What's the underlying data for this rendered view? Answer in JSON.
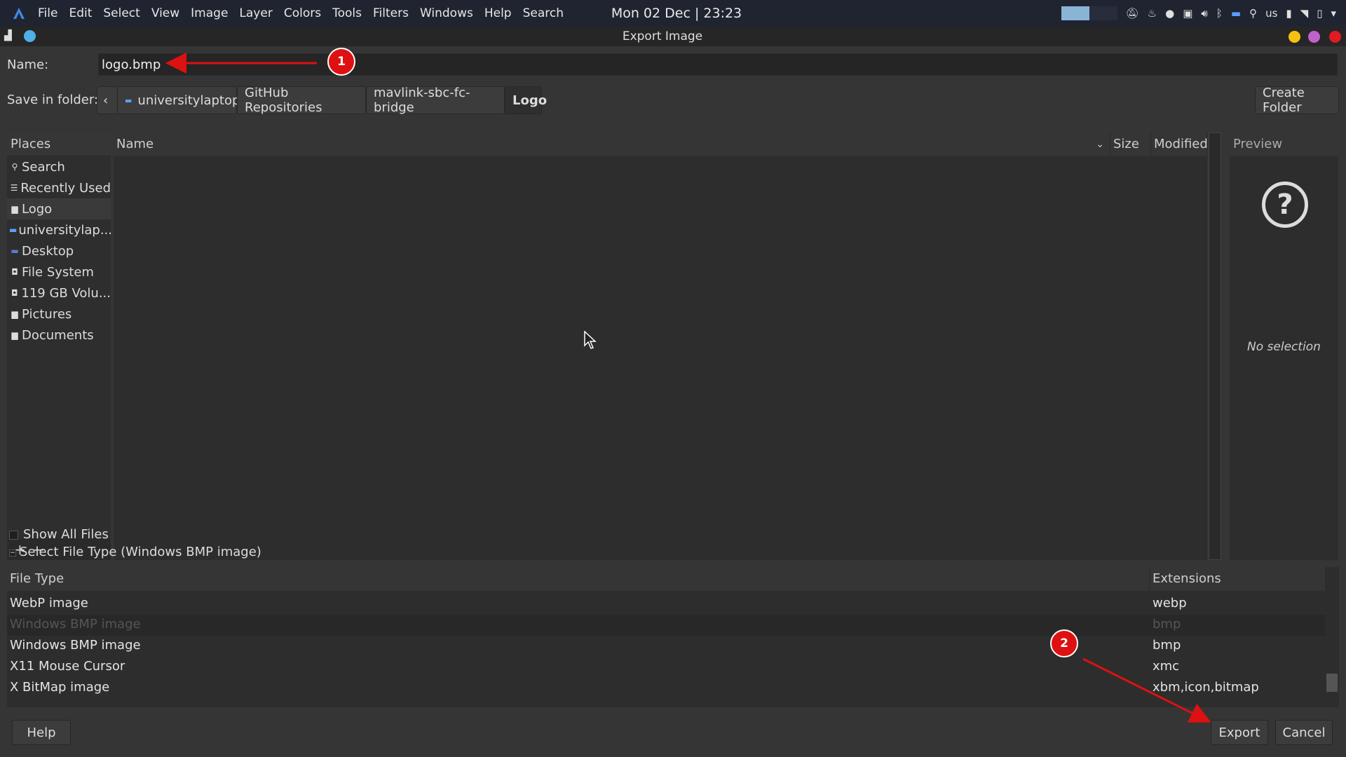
{
  "topbar": {
    "menus": [
      "File",
      "Edit",
      "Select",
      "View",
      "Image",
      "Layer",
      "Colors",
      "Tools",
      "Filters",
      "Windows",
      "Help",
      "Search"
    ],
    "clock": "Mon 02 Dec | 23:23",
    "keyboard_layout": "us"
  },
  "window": {
    "title": "Export Image",
    "buttons": {
      "minimize_color": "#f5c211",
      "maximize_color": "#c061cb",
      "close_color": "#e01b24"
    }
  },
  "name_row": {
    "label": "Name:",
    "value": "logo.bmp"
  },
  "folder_row": {
    "label": "Save in folder:",
    "path": [
      "universitylaptop",
      "GitHub Repositories",
      "mavlink-sbc-fc-bridge",
      "Logo"
    ],
    "create_folder": "Create Folder"
  },
  "places": {
    "header": "Places",
    "items": [
      {
        "label": "Search",
        "icon": "search-icon"
      },
      {
        "label": "Recently Used",
        "icon": "recent-icon"
      },
      {
        "label": "Logo",
        "icon": "folder-icon"
      },
      {
        "label": "universitylap...",
        "icon": "home-folder-icon"
      },
      {
        "label": "Desktop",
        "icon": "desktop-icon"
      },
      {
        "label": "File System",
        "icon": "drive-icon"
      },
      {
        "label": "119 GB Volu...",
        "icon": "drive-icon"
      },
      {
        "label": "Pictures",
        "icon": "folder-icon"
      },
      {
        "label": "Documents",
        "icon": "folder-icon"
      }
    ]
  },
  "filelist": {
    "col_name": "Name",
    "col_size": "Size",
    "col_modified": "Modified"
  },
  "preview": {
    "header": "Preview",
    "empty_text": "No selection"
  },
  "show_all_files": "Show All Files",
  "select_file_type": "Select File Type (Windows BMP image)",
  "filetypes": {
    "col_type": "File Type",
    "col_ext": "Extensions",
    "rows": [
      {
        "type": "WebP image",
        "ext": "webp"
      },
      {
        "type": "Windows BMP image",
        "ext": "bmp"
      },
      {
        "type": "Windows BMP image",
        "ext": "bmp"
      },
      {
        "type": "X11 Mouse Cursor",
        "ext": "xmc"
      },
      {
        "type": "X BitMap image",
        "ext": "xbm,icon,bitmap"
      }
    ]
  },
  "buttons": {
    "help": "Help",
    "export": "Export",
    "cancel": "Cancel"
  },
  "annotations": {
    "badge1": "1",
    "badge2": "2",
    "color": "#dd1111"
  }
}
